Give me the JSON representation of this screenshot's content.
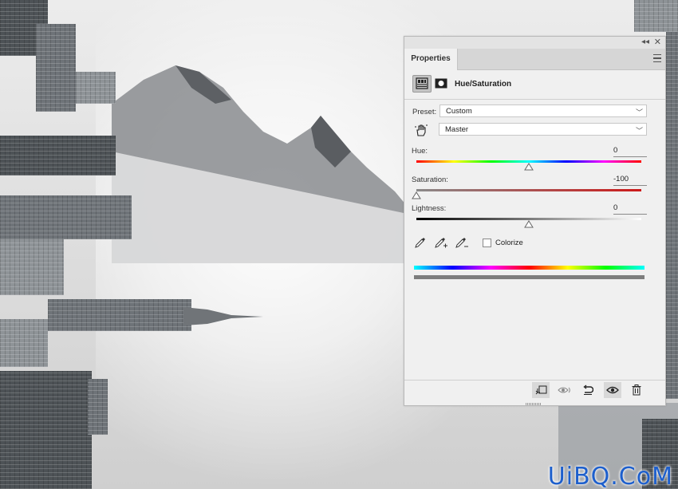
{
  "panel": {
    "tab_label": "Properties",
    "title": "Hue/Saturation",
    "preset_label": "Preset:",
    "preset_value": "Custom",
    "channel_value": "Master",
    "hue": {
      "label": "Hue:",
      "value": "0",
      "level": 0.5
    },
    "saturation": {
      "label": "Saturation:",
      "value": "-100",
      "level": 0
    },
    "lightness": {
      "label": "Lightness:",
      "value": "0",
      "level": 0.5
    },
    "colorize_label": "Colorize",
    "colorize_checked": false,
    "icons": {
      "collapse": "double-chevron-left-icon",
      "close": "close-icon",
      "menu": "panel-menu-icon",
      "adjustment": "hue-saturation-layer-icon",
      "mask": "layer-mask-icon",
      "targeted_adjust": "hand-scrubby-icon",
      "eyedropper": "eyedropper-icon",
      "eyedropper_add": "eyedropper-plus-icon",
      "eyedropper_subtract": "eyedropper-minus-icon",
      "clip": "clip-to-layer-icon",
      "view_previous": "view-previous-state-icon",
      "reset": "reset-icon",
      "visibility": "eye-icon",
      "delete": "trash-icon"
    }
  },
  "watermark": "UiBQ.CoM",
  "colors": {
    "panel_bg": "#f0f0f0",
    "accent_red": "#cc2222",
    "watermark_blue": "#1d5fcc"
  }
}
